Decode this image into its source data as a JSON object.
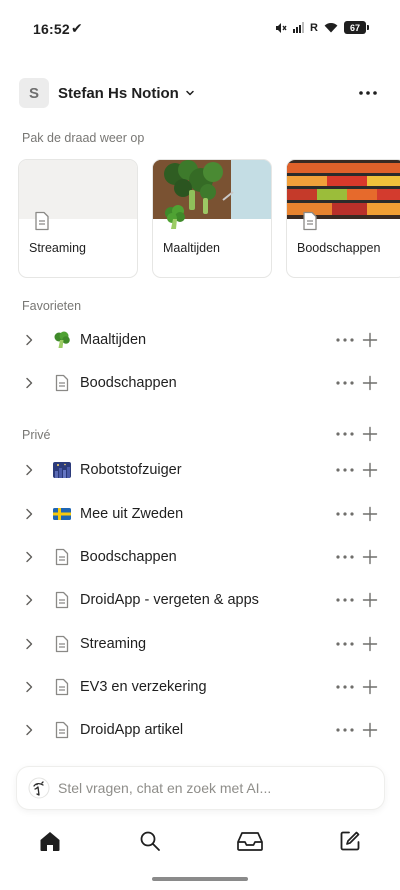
{
  "status": {
    "time": "16:52",
    "carrier": "R",
    "battery": "67"
  },
  "workspace": {
    "avatar_letter": "S",
    "name": "Stefan Hs Notion"
  },
  "recent": {
    "heading": "Pak de draad weer op",
    "cards": [
      {
        "title": "Streaming",
        "cover": "none",
        "icon": "page-icon"
      },
      {
        "title": "Maaltijden",
        "cover": "broccoli-photo",
        "icon": "broccoli-icon"
      },
      {
        "title": "Boodschappen",
        "cover": "produce-photo",
        "icon": "page-icon"
      }
    ]
  },
  "favorites": {
    "heading": "Favorieten",
    "items": [
      {
        "label": "Maaltijden",
        "icon": "broccoli-icon",
        "glyph": "🥦"
      },
      {
        "label": "Boodschappen",
        "icon": "page-icon",
        "glyph": ""
      }
    ]
  },
  "private": {
    "heading": "Privé",
    "items": [
      {
        "label": "Robotstofzuiger",
        "icon": "night-image-icon",
        "glyph": "🌃"
      },
      {
        "label": "Mee uit Zweden",
        "icon": "sweden-flag-icon",
        "glyph": ""
      },
      {
        "label": "Boodschappen",
        "icon": "page-icon",
        "glyph": ""
      },
      {
        "label": "DroidApp - vergeten & apps",
        "icon": "page-icon",
        "glyph": ""
      },
      {
        "label": "Streaming",
        "icon": "page-icon",
        "glyph": ""
      },
      {
        "label": "EV3 en verzekering",
        "icon": "page-icon",
        "glyph": ""
      },
      {
        "label": "DroidApp artikel",
        "icon": "page-icon",
        "glyph": ""
      }
    ]
  },
  "ask": {
    "placeholder": "Stel vragen, chat en zoek met AI..."
  },
  "tabs": [
    {
      "name": "home-icon"
    },
    {
      "name": "search-icon"
    },
    {
      "name": "inbox-icon"
    },
    {
      "name": "new-page-icon"
    }
  ]
}
